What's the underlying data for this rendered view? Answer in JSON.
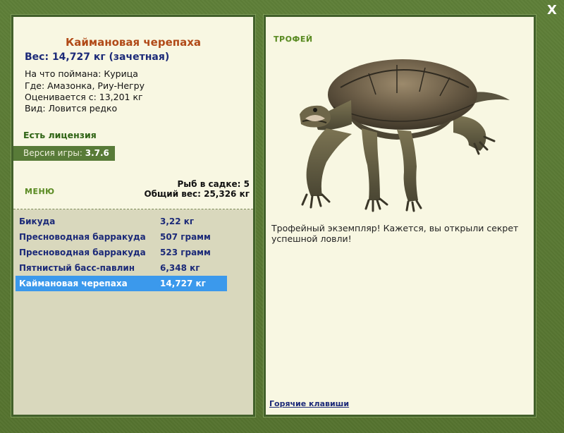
{
  "close_label": "X",
  "fish": {
    "name": "Каймановая черепаха",
    "weight": "Вес: 14,727 кг (зачетная)",
    "bait": "На что поймана: Курица",
    "location": "Где: Амазонка, Риу-Негру",
    "rated_from": "Оценивается с: 13,201 кг",
    "kind": "Вид: Ловится редко"
  },
  "license": "Есть лицензия",
  "version": {
    "label": "Версия игры:",
    "value": "3.7.6"
  },
  "menu_label": "МЕНЮ",
  "keepnet": {
    "fish_count": "Рыб в садке: 5",
    "total_weight": "Общий вес: 25,326 кг"
  },
  "catch_list": [
    {
      "name": "Бикуда",
      "weight": "3,22 кг"
    },
    {
      "name": "Пресноводная барракуда",
      "weight": "507 грамм"
    },
    {
      "name": "Пресноводная барракуда",
      "weight": "523 грамм"
    },
    {
      "name": "Пятнистый басс-павлин",
      "weight": "6,348 кг"
    },
    {
      "name": "Каймановая черепаха",
      "weight": "14,727 кг"
    }
  ],
  "trophy": {
    "title": "ТРОФЕЙ",
    "description": "Трофейный экземпляр! Кажется, вы открыли секрет успешной ловли!"
  },
  "hotkeys_label": "Горячие клавиши",
  "colors": {
    "frame": "#5a7a36",
    "panel": "#f8f7e2",
    "list_bg": "#d9d8bd",
    "title": "#b14a18",
    "weight": "#1c2a78",
    "accent_green": "#5a8a22",
    "selected": "#3b99ec"
  }
}
